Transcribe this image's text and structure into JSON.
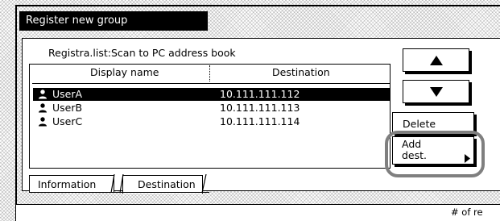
{
  "dialog": {
    "title": "Register new group"
  },
  "list": {
    "title": "Registra.list:Scan to PC address book",
    "columns": {
      "display_name": "Display name",
      "destination": "Destination"
    },
    "rows": [
      {
        "name": "UserA",
        "destination": "10.111.111.112",
        "selected": true,
        "icon": "user-icon"
      },
      {
        "name": "UserB",
        "destination": "10.111.111.113",
        "selected": false,
        "icon": "user-icon"
      },
      {
        "name": "UserC",
        "destination": "10.111.111.114",
        "selected": false,
        "icon": "user-icon"
      }
    ]
  },
  "buttons": {
    "scroll_up": {
      "icon": "triangle-up-icon"
    },
    "scroll_down": {
      "icon": "triangle-down-icon"
    },
    "delete": "Delete",
    "add_dest_line1": "Add",
    "add_dest_line2": "dest.",
    "add_dest_icon": "triangle-right-icon"
  },
  "tabs": [
    {
      "label": "Information",
      "active": false
    },
    {
      "label": "Destination",
      "active": true
    }
  ],
  "status_bar": {
    "text": "# of re"
  }
}
